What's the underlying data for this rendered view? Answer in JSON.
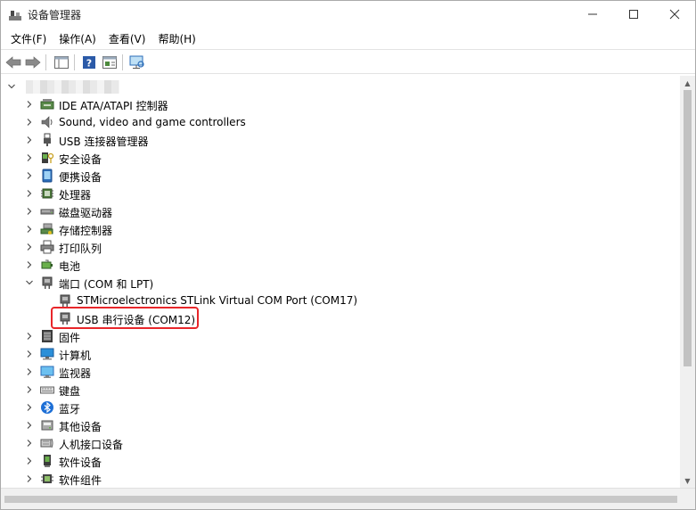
{
  "window": {
    "title": "设备管理器"
  },
  "menu": [
    "文件(F)",
    "操作(A)",
    "查看(V)",
    "帮助(H)"
  ],
  "tree": {
    "root_label": "",
    "items": [
      {
        "label": "IDE ATA/ATAPI 控制器",
        "icon": "ide-controller-icon",
        "expanded": false
      },
      {
        "label": "Sound, video and game controllers",
        "icon": "speaker-icon",
        "expanded": false
      },
      {
        "label": "USB 连接器管理器",
        "icon": "usb-plug-icon",
        "expanded": false
      },
      {
        "label": "安全设备",
        "icon": "security-key-icon",
        "expanded": false
      },
      {
        "label": "便携设备",
        "icon": "portable-device-icon",
        "expanded": false
      },
      {
        "label": "处理器",
        "icon": "cpu-icon",
        "expanded": false
      },
      {
        "label": "磁盘驱动器",
        "icon": "disk-drive-icon",
        "expanded": false
      },
      {
        "label": "存储控制器",
        "icon": "storage-controller-icon",
        "expanded": false
      },
      {
        "label": "打印队列",
        "icon": "printer-icon",
        "expanded": false
      },
      {
        "label": "电池",
        "icon": "battery-icon",
        "expanded": false
      },
      {
        "label": "端口 (COM 和 LPT)",
        "icon": "port-icon",
        "expanded": true
      },
      {
        "label": "STMicroelectronics STLink Virtual COM Port (COM17)",
        "icon": "port-icon",
        "child": true
      },
      {
        "label": "USB 串行设备 (COM12)",
        "icon": "port-icon",
        "child": true,
        "highlighted": true
      },
      {
        "label": "固件",
        "icon": "firmware-icon",
        "expanded": false
      },
      {
        "label": "计算机",
        "icon": "computer-icon",
        "expanded": false
      },
      {
        "label": "监视器",
        "icon": "monitor-icon",
        "expanded": false
      },
      {
        "label": "键盘",
        "icon": "keyboard-icon",
        "expanded": false
      },
      {
        "label": "蓝牙",
        "icon": "bluetooth-icon",
        "expanded": false
      },
      {
        "label": "其他设备",
        "icon": "other-device-icon",
        "expanded": false
      },
      {
        "label": "人机接口设备",
        "icon": "hid-icon",
        "expanded": false
      },
      {
        "label": "软件设备",
        "icon": "software-device-icon",
        "expanded": false
      },
      {
        "label": "软件组件",
        "icon": "software-component-icon",
        "expanded": false
      }
    ]
  },
  "colors": {
    "highlight": "#e8262a",
    "accent": "#2b6cb8"
  }
}
